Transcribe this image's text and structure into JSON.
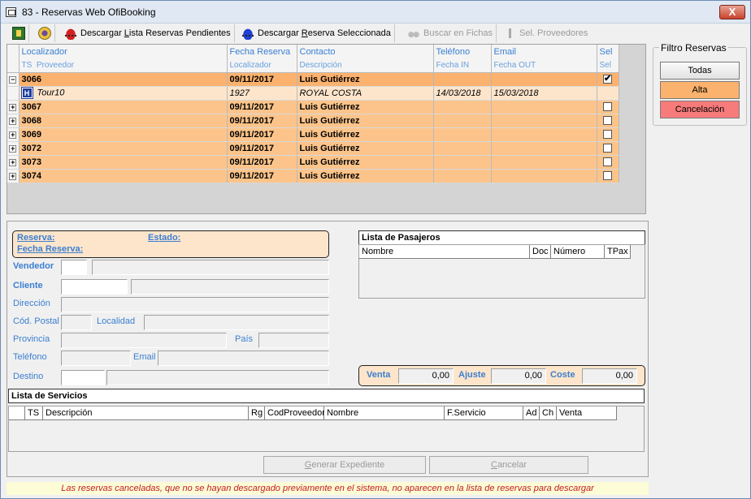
{
  "window": {
    "title": "83 - Reservas Web OfiBooking",
    "close_label": "X"
  },
  "toolbar": {
    "download_pending_pre": "Descargar ",
    "download_pending_u": "L",
    "download_pending_post": "ista Reservas Pendientes",
    "download_selected_pre": "Descargar ",
    "download_selected_u": "R",
    "download_selected_post": "eserva Seleccionada",
    "search_label": "Buscar en Fichas",
    "providers_label": "Sel. Proveedores"
  },
  "grid": {
    "headers1": {
      "localizador": "Localizador",
      "fecha": "Fecha Reserva",
      "contacto": "Contacto",
      "telefono": "Teléfono",
      "email": "Email",
      "sel": "Sel"
    },
    "headers2": {
      "ts": "TS",
      "proveedor": "Proveedor",
      "localizador": "Localizador",
      "descripcion": "Descripción",
      "fecha_in": "Fecha IN",
      "fecha_out": "Fecha OUT",
      "sel": "Sel"
    },
    "rows": [
      {
        "exp": "−",
        "id": "3066",
        "fecha": "09/11/2017",
        "contacto": "Luis Gutiérrez",
        "checked": true
      },
      {
        "exp": "+",
        "id": "3067",
        "fecha": "09/11/2017",
        "contacto": "Luis Gutiérrez",
        "checked": false
      },
      {
        "exp": "+",
        "id": "3068",
        "fecha": "09/11/2017",
        "contacto": "Luis Gutiérrez",
        "checked": false
      },
      {
        "exp": "+",
        "id": "3069",
        "fecha": "09/11/2017",
        "contacto": "Luis Gutiérrez",
        "checked": false
      },
      {
        "exp": "+",
        "id": "3072",
        "fecha": "09/11/2017",
        "contacto": "Luis Gutiérrez",
        "checked": false
      },
      {
        "exp": "+",
        "id": "3073",
        "fecha": "09/11/2017",
        "contacto": "Luis Gutiérrez",
        "checked": false
      },
      {
        "exp": "+",
        "id": "3074",
        "fecha": "09/11/2017",
        "contacto": "Luis Gutiérrez",
        "checked": false
      }
    ],
    "subrow": {
      "ts_badge": "H",
      "proveedor": "Tour10",
      "localizador": "1927",
      "descripcion": "ROYAL COSTA",
      "fecha_in": "14/03/2018",
      "fecha_out": "15/03/2018"
    }
  },
  "filter": {
    "title": "Filtro  Reservas",
    "todas": "Todas",
    "alta": "Alta",
    "cancelacion": "Cancelación"
  },
  "detail": {
    "reserva": "Reserva:",
    "estado": "Estado:",
    "fecha_reserva": "Fecha Reserva:",
    "vendedor": "Vendedor",
    "cliente": "Cliente",
    "direccion": "Dirección",
    "cod_postal": "Cód. Postal",
    "localidad": "Localidad",
    "provincia": "Provincia",
    "pais": "País",
    "telefono": "Teléfono",
    "email": "Email",
    "destino": "Destino"
  },
  "pasajeros": {
    "title": "Lista de Pasajeros",
    "cols": [
      "Nombre",
      "Doc",
      "Número",
      "TPax"
    ]
  },
  "totals": {
    "venta_label": "Venta",
    "venta": "0,00",
    "ajuste_label": "Ajuste",
    "ajuste": "0,00",
    "coste_label": "Coste",
    "coste": "0,00"
  },
  "servicios": {
    "title": "Lista de Servicios",
    "cols": [
      "TS",
      "Descripción",
      "Rg",
      "CodProveedor",
      "Nombre",
      "F.Servicio",
      "Ad",
      "Ch",
      "Venta"
    ]
  },
  "actions": {
    "generar_pre": "",
    "generar_u": "G",
    "generar_post": "enerar Expediente",
    "cancelar_pre": "",
    "cancelar_u": "C",
    "cancelar_post": "ancelar"
  },
  "footer": "Las reservas canceladas, que no se hayan descargado previamente en el sistema, no aparecen en la lista de reservas para descargar"
}
